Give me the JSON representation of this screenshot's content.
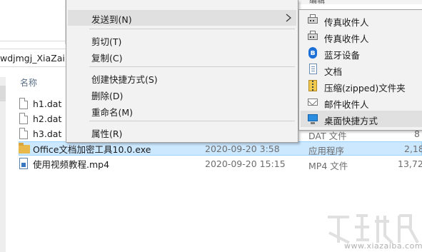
{
  "explorer": {
    "address_path": "wdjmgj_XiaZaiBa",
    "column_header_name": "名称",
    "files": [
      {
        "name": "h1.dat",
        "icon": "dat-file-icon",
        "date": "",
        "type": "",
        "size": ""
      },
      {
        "name": "h2.dat",
        "icon": "dat-file-icon",
        "date": "",
        "type": "",
        "size": ""
      },
      {
        "name": "h3.dat",
        "icon": "dat-file-icon",
        "date": "",
        "type": "DAT 文件",
        "size": "8"
      },
      {
        "name": "Office文档加密工具10.0.exe",
        "icon": "folder-icon",
        "date": "2020-09-20 3:58",
        "type": "应用程序",
        "size": "2,18"
      },
      {
        "name": "使用视频教程.mp4",
        "icon": "mp4-file-icon",
        "date": "2020-09-20 15:15",
        "type": "MP4 文件",
        "size": "13,72"
      }
    ],
    "selected_index": 3,
    "right_fragment_label": "编辑",
    "selection_color": "#cce8ff"
  },
  "context_menu": {
    "items": [
      {
        "label": "发送到(N)",
        "has_submenu": true,
        "hover": true
      },
      {
        "label": "剪切(T)"
      },
      {
        "label": "复制(C)"
      },
      {
        "label": "创建快捷方式(S)"
      },
      {
        "label": "删除(D)"
      },
      {
        "label": "重命名(M)"
      },
      {
        "label": "属性(R)"
      }
    ]
  },
  "submenu": {
    "items": [
      {
        "label": "传真收件人",
        "icon": "fax-icon"
      },
      {
        "label": "传真收件人",
        "icon": "fax-icon"
      },
      {
        "label": "蓝牙设备",
        "icon": "bluetooth-icon",
        "glyph": "ʙ"
      },
      {
        "label": "文档",
        "icon": "document-icon"
      },
      {
        "label": "压缩(zipped)文件夹",
        "icon": "zip-folder-icon"
      },
      {
        "label": "邮件收件人",
        "icon": "mail-icon"
      },
      {
        "label": "桌面快捷方式",
        "icon": "desktop-icon",
        "hover": true
      }
    ],
    "accent_color": "#1b6fd6"
  },
  "watermark": {
    "text": "www.xiazaiba.com"
  }
}
